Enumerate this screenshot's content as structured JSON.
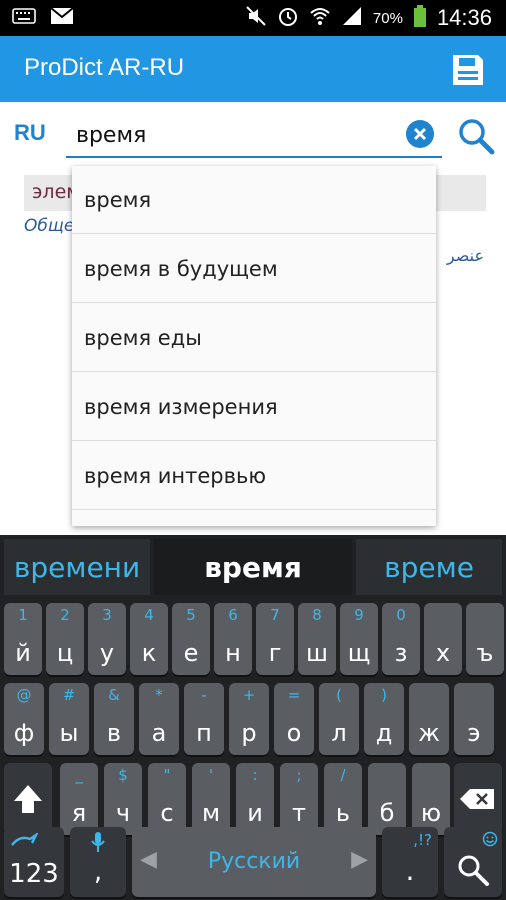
{
  "status_bar": {
    "battery_text": "70%",
    "time": "14:36",
    "icons": [
      "keyboard-icon",
      "gmail-icon",
      "mute-icon",
      "alarm-icon",
      "wifi-icon",
      "signal-icon",
      "battery-icon"
    ]
  },
  "app": {
    "title": "ProDict AR-RU",
    "accent_color": "#2196e3"
  },
  "search": {
    "lang": "RU",
    "value": "время"
  },
  "background_result": {
    "word": "элем",
    "category": "Обще",
    "arabic": "عنصر"
  },
  "suggestions": [
    "время",
    "время в будущем",
    "время еды",
    "время измерения",
    "время интервью"
  ],
  "keyboard": {
    "candidates": [
      "времени",
      "время",
      "време"
    ],
    "row1": [
      {
        "hint": "1",
        "key": "й"
      },
      {
        "hint": "2",
        "key": "ц"
      },
      {
        "hint": "3",
        "key": "у"
      },
      {
        "hint": "4",
        "key": "к"
      },
      {
        "hint": "5",
        "key": "е"
      },
      {
        "hint": "6",
        "key": "н"
      },
      {
        "hint": "7",
        "key": "г"
      },
      {
        "hint": "8",
        "key": "ш"
      },
      {
        "hint": "9",
        "key": "щ"
      },
      {
        "hint": "0",
        "key": "з"
      },
      {
        "hint": "",
        "key": "х"
      },
      {
        "hint": "",
        "key": "ъ"
      }
    ],
    "row2": [
      {
        "hint": "@",
        "key": "ф"
      },
      {
        "hint": "#",
        "key": "ы"
      },
      {
        "hint": "&",
        "key": "в"
      },
      {
        "hint": "*",
        "key": "а"
      },
      {
        "hint": "-",
        "key": "п"
      },
      {
        "hint": "+",
        "key": "р"
      },
      {
        "hint": "=",
        "key": "о"
      },
      {
        "hint": "(",
        "key": "л"
      },
      {
        "hint": ")",
        "key": "д"
      },
      {
        "hint": "",
        "key": "ж"
      },
      {
        "hint": "",
        "key": "э"
      }
    ],
    "row3": [
      {
        "hint": "_",
        "key": "я"
      },
      {
        "hint": "$",
        "key": "ч"
      },
      {
        "hint": "\"",
        "key": "с"
      },
      {
        "hint": "'",
        "key": "м"
      },
      {
        "hint": ":",
        "key": "и"
      },
      {
        "hint": ";",
        "key": "т"
      },
      {
        "hint": "/",
        "key": "ь"
      },
      {
        "hint": "",
        "key": "б"
      },
      {
        "hint": "",
        "key": "ю"
      }
    ],
    "numbers_key": "123",
    "comma_key": ",",
    "space_label": "Русский",
    "period_key": ".",
    "period_hint": ",!?"
  }
}
